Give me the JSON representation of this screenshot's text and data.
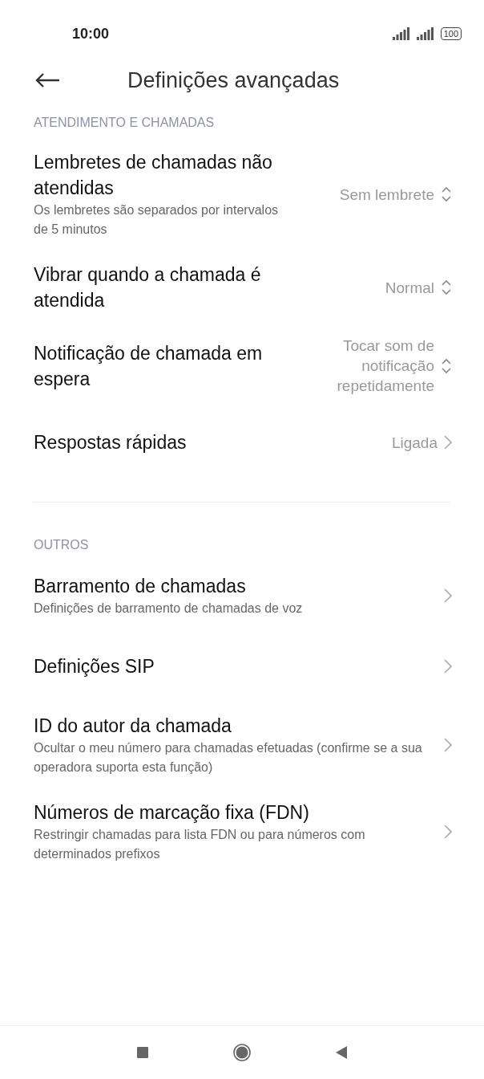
{
  "status_bar": {
    "time": "10:00",
    "battery": "100"
  },
  "header": {
    "title": "Definições avançadas"
  },
  "sections": [
    {
      "label": "ATENDIMENTO E CHAMADAS",
      "items": [
        {
          "kind": "select",
          "title": "Lembretes de chamadas não atendidas",
          "subtitle": "Os lembretes são separados por intervalos de 5 minutos",
          "value": "Sem lembrete"
        },
        {
          "kind": "select",
          "title": "Vibrar quando a chamada é atendida",
          "value": "Normal"
        },
        {
          "kind": "select",
          "title": "Notificação de chamada em espera",
          "value": "Tocar som de notificação repetidamente"
        },
        {
          "kind": "link",
          "title": "Respostas rápidas",
          "value": "Ligada"
        }
      ]
    },
    {
      "label": "OUTROS",
      "items": [
        {
          "kind": "link",
          "title": "Barramento de chamadas",
          "subtitle": "Definições de barramento de chamadas de voz"
        },
        {
          "kind": "link",
          "title": "Definições SIP"
        },
        {
          "kind": "link",
          "title": "ID do autor da chamada",
          "subtitle": "Ocultar o meu número para chamadas efetuadas (confirme se a sua operadora suporta esta função)"
        },
        {
          "kind": "link",
          "title": "Números de marcação fixa (FDN)",
          "subtitle": "Restringir chamadas para lista FDN ou para números com determinados prefixos"
        }
      ]
    }
  ]
}
